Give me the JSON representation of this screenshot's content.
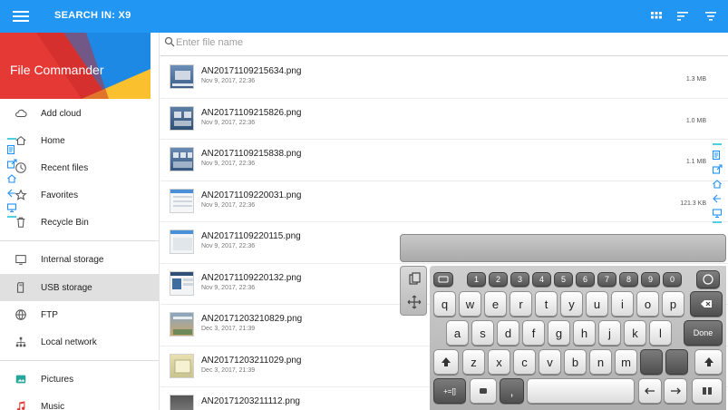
{
  "topbar": {
    "title": "SEARCH IN: X9",
    "bg_color": "#2196f3",
    "icons": [
      "menu-icon",
      "grid-view-icon",
      "sort-icon",
      "filter-icon"
    ]
  },
  "drawer": {
    "app_name": "File Commander",
    "items": [
      {
        "label": "Add cloud",
        "icon": "cloud-icon"
      },
      {
        "label": "Home",
        "icon": "home-icon"
      },
      {
        "label": "Recent files",
        "icon": "clock-icon"
      },
      {
        "label": "Favorites",
        "icon": "star-icon"
      },
      {
        "label": "Recycle Bin",
        "icon": "trash-icon"
      },
      {
        "label": "Internal storage",
        "icon": "tablet-icon"
      },
      {
        "label": "USB storage",
        "icon": "sd-card-icon",
        "active": true
      },
      {
        "label": "FTP",
        "icon": "globe-icon"
      },
      {
        "label": "Local network",
        "icon": "network-icon"
      },
      {
        "label": "Pictures",
        "icon": "pictures-icon"
      },
      {
        "label": "Music",
        "icon": "music-icon"
      }
    ]
  },
  "search": {
    "placeholder": "Enter file name",
    "value": ""
  },
  "files": [
    {
      "name": "AN20171109215634.png",
      "date": "Nov 9, 2017, 22:36",
      "size": "1.3 MB"
    },
    {
      "name": "AN20171109215826.png",
      "date": "Nov 9, 2017, 22:36",
      "size": "1.0 MB"
    },
    {
      "name": "AN20171109215838.png",
      "date": "Nov 9, 2017, 22:36",
      "size": "1.1 MB"
    },
    {
      "name": "AN20171109220031.png",
      "date": "Nov 9, 2017, 22:36",
      "size": "121.3 KB"
    },
    {
      "name": "AN20171109220115.png",
      "date": "Nov 9, 2017, 22:36",
      "size": ""
    },
    {
      "name": "AN20171109220132.png",
      "date": "Nov 9, 2017, 22:36",
      "size": ""
    },
    {
      "name": "AN20171203210829.png",
      "date": "Dec 3, 2017, 21:39",
      "size": ""
    },
    {
      "name": "AN20171203211029.png",
      "date": "Dec 3, 2017, 21:39",
      "size": ""
    },
    {
      "name": "AN20171203211112.png",
      "date": "",
      "size": ""
    }
  ],
  "keyboard": {
    "number_row": [
      "1",
      "2",
      "3",
      "4",
      "5",
      "6",
      "7",
      "8",
      "9",
      "0"
    ],
    "row1": [
      "q",
      "w",
      "e",
      "r",
      "t",
      "y",
      "u",
      "i",
      "o",
      "p"
    ],
    "row1_hints": [
      "",
      "",
      "",
      "",
      "",
      "",
      "",
      "",
      "",
      ""
    ],
    "row2": [
      "a",
      "s",
      "d",
      "f",
      "g",
      "h",
      "j",
      "k",
      "l"
    ],
    "row2_hints": [
      "@",
      "",
      "",
      "",
      "",
      "",
      "",
      "",
      ""
    ],
    "row3": [
      "z",
      "x",
      "c",
      "v",
      "b",
      "n",
      "m"
    ],
    "done_label": "Done",
    "comma_label": ",",
    "symbols_label": "+=[]"
  }
}
